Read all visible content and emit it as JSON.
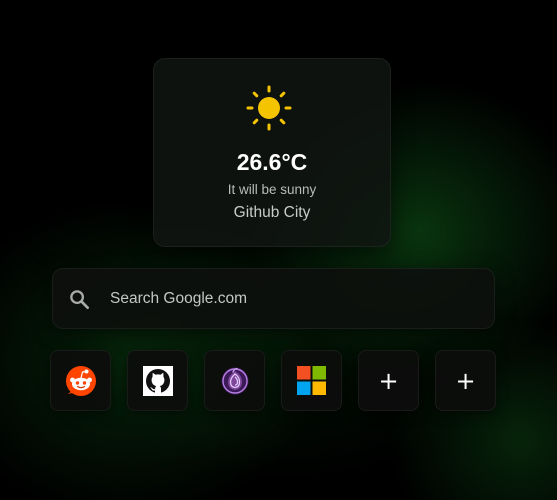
{
  "weather": {
    "icon": "sun-icon",
    "temperature": "26.6°C",
    "description": "It will be sunny",
    "location": "Github City",
    "icon_color": "#f5c400"
  },
  "search": {
    "placeholder": "Search Google.com",
    "icon": "search-icon"
  },
  "shortcuts": [
    {
      "name": "reddit",
      "icon": "reddit-icon",
      "color": "#ff4500"
    },
    {
      "name": "github",
      "icon": "github-icon",
      "color": "#ffffff"
    },
    {
      "name": "tor",
      "icon": "tor-onion-icon",
      "color": "#7d4698"
    },
    {
      "name": "microsoft",
      "icon": "microsoft-icon",
      "colors": [
        "#f25022",
        "#7fba00",
        "#00a4ef",
        "#ffb900"
      ]
    },
    {
      "name": "add",
      "icon": "plus-icon",
      "label": "+"
    },
    {
      "name": "add",
      "icon": "plus-icon",
      "label": "+"
    }
  ]
}
